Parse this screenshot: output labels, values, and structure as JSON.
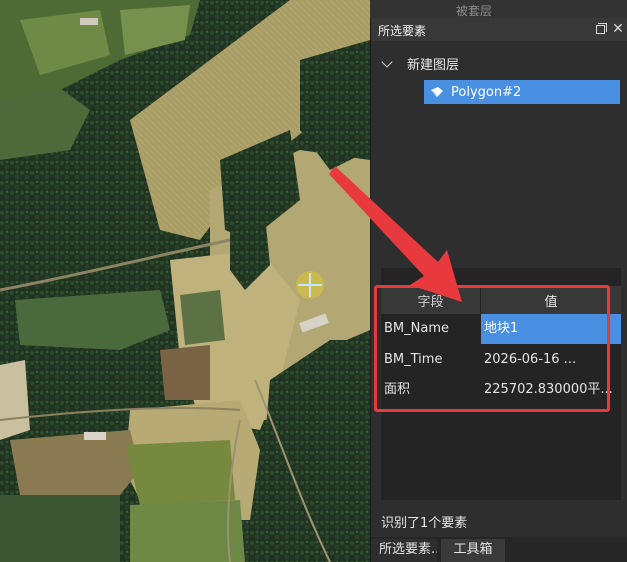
{
  "map": {
    "description_icon": "crosshair-marker-icon"
  },
  "background_tab": {
    "label": "被套层"
  },
  "panel": {
    "title": "所选要素",
    "restore_icon": "restore-window-icon",
    "close_icon": "close-icon",
    "tree": {
      "root_label": "新建图层",
      "child_label": "Polygon#2",
      "child_icon": "polygon-icon"
    },
    "attributes": {
      "header_field": "字段",
      "header_value": "值",
      "rows": [
        {
          "field": "BM_Name",
          "value": "地块1"
        },
        {
          "field": "BM_Time",
          "value": "2026-06-16 ..."
        },
        {
          "field": "面积",
          "value": "225702.830000平..."
        }
      ]
    },
    "status": "识别了1个要素",
    "tabs": [
      {
        "label": "所选要素..."
      },
      {
        "label": "工具箱"
      }
    ]
  },
  "colors": {
    "selection": "#4a90e2",
    "annotation": "#e8393f",
    "panel_bg": "#2e2e2e"
  }
}
